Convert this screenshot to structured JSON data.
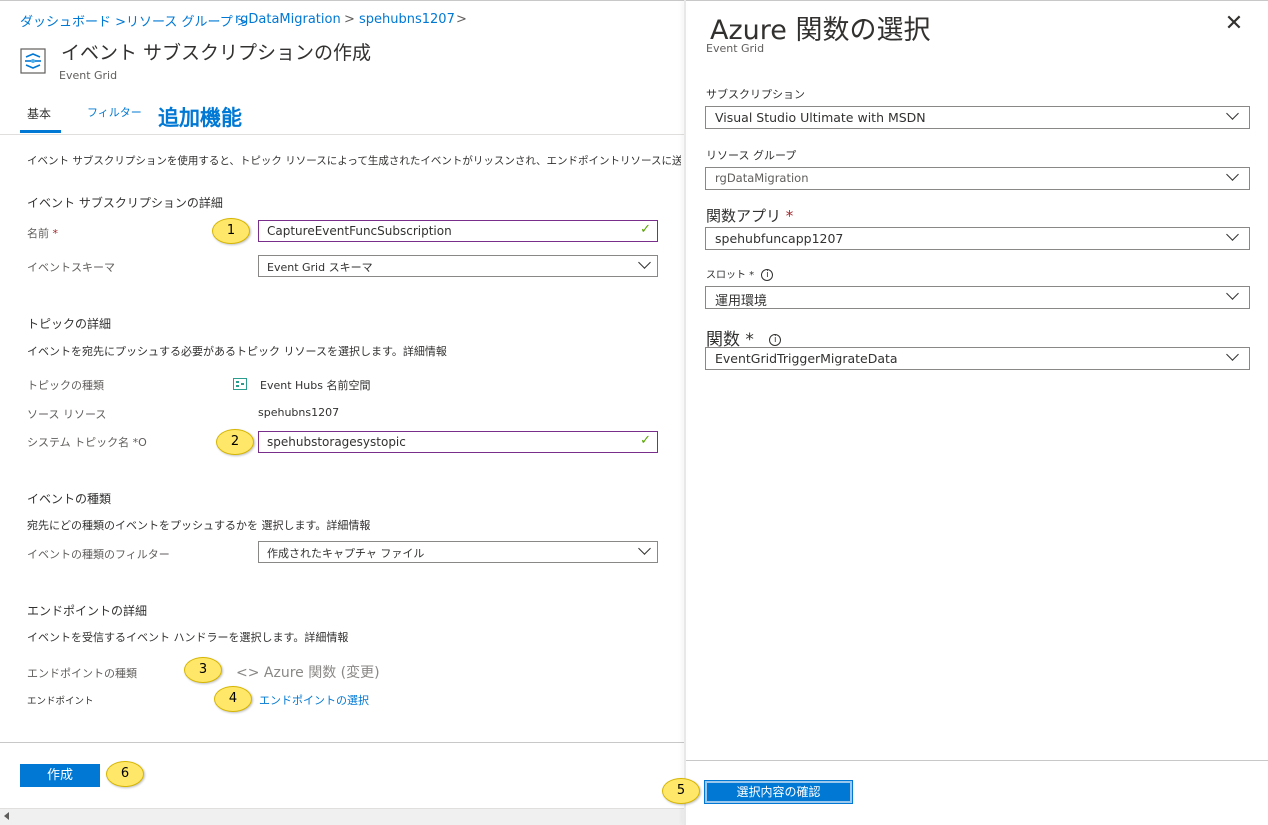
{
  "breadcrumb": {
    "item1": "ダッシュボード >リソース グループ >",
    "item2": "rgDataMigration",
    "sep": ">",
    "item3": "spehubns1207",
    "sep2": ">"
  },
  "header": {
    "title": "イベント サブスクリプションの作成",
    "subtitle": "Event Grid",
    "icon": "event-grid-icon"
  },
  "tabs": {
    "basic": "基本",
    "filter": "フィルター",
    "extra": "追加機能"
  },
  "intro": "イベント サブスクリプションを使用すると、トピック リソースによって生成されたイベントがリッスンされ、エンドポイントリソースに送信されます。詳細情報",
  "subscription_details": {
    "heading": "イベント サブスクリプションの詳細",
    "name_label": "名前",
    "required_mark": "*",
    "name_value": "CaptureEventFuncSubscription",
    "schema_label": "イベントスキーマ",
    "schema_value": "Event Grid スキーマ"
  },
  "topic_details": {
    "heading": "トピックの詳細",
    "description": "イベントを宛先にプッシュする必要があるトピック リソースを選択します。詳細情報",
    "type_label": "トピックの種類",
    "type_value": "Event Hubs 名前空間",
    "source_label": "ソース リソース",
    "source_value": "spehubns1207",
    "system_topic_label": "システム トピック名 *O",
    "system_topic_value": "spehubstoragesystopic"
  },
  "event_types": {
    "heading": "イベントの種類",
    "description": "宛先にどの種類のイベントをプッシュするかを 選択します。詳細情報",
    "filter_label": "イベントの種類のフィルター",
    "filter_value": "作成されたキャプチャ ファイル"
  },
  "endpoint_details": {
    "heading": "エンドポイントの詳細",
    "description": "イベントを受信するイベント ハンドラーを選択します。詳細情報",
    "type_label": "エンドポイントの種類",
    "type_value": "<> Azure 関数 (変更)",
    "endpoint_label": "エンドポイント",
    "endpoint_link": "エンドポイントの選択"
  },
  "callouts": [
    "1",
    "2",
    "3",
    "4",
    "5",
    "6"
  ],
  "create_button": "作成",
  "pane": {
    "title": "Azure 関数の選択",
    "subtitle": "Event Grid",
    "close_icon": "close-icon",
    "subscription_label": "サブスクリプション",
    "subscription_value": "Visual Studio Ultimate with MSDN",
    "resource_group_label": "リソース グループ",
    "resource_group_value": "rgDataMigration",
    "function_app_label": "関数アプリ",
    "function_app_value": "spehubfuncapp1207",
    "slot_label": "スロット *",
    "slot_value": "運用環境",
    "function_label": "関数 *",
    "function_value": "EventGridTriggerMigrateData",
    "info_glyph": "i",
    "confirm_button": "選択内容の確認"
  },
  "colors": {
    "accent": "#0078d4",
    "callout": "#ffe76a",
    "valid": "#57a300",
    "active_border": "#7a2e8c"
  }
}
